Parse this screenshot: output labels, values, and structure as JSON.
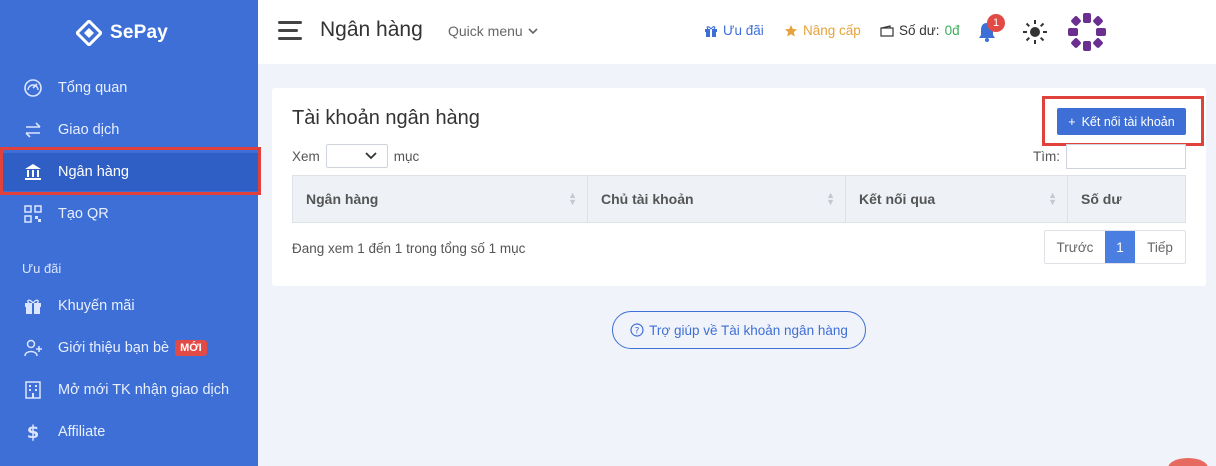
{
  "app": {
    "brand": "SePay"
  },
  "sidebar": {
    "items": [
      {
        "label": "Tổng quan",
        "icon": "dashboard-icon"
      },
      {
        "label": "Giao dịch",
        "icon": "transfer-icon"
      },
      {
        "label": "Ngân hàng",
        "icon": "bank-icon",
        "active": true
      },
      {
        "label": "Tạo QR",
        "icon": "qr-icon"
      }
    ],
    "section_label": "Ưu đãi",
    "promo_items": [
      {
        "label": "Khuyến mãi",
        "icon": "gift-icon"
      },
      {
        "label": "Giới thiệu bạn bè",
        "icon": "user-plus-icon",
        "badge": "MỚI"
      },
      {
        "label": "Mở mới TK nhận giao dịch",
        "icon": "building-icon"
      },
      {
        "label": "Affiliate",
        "icon": "dollar-icon"
      }
    ]
  },
  "header": {
    "title": "Ngân hàng",
    "quick_menu": "Quick menu",
    "promo": "Ưu đãi",
    "upgrade": "Nâng cấp",
    "balance_label": "Số dư:",
    "balance_value": "0đ",
    "notification_count": "1"
  },
  "card": {
    "title": "Tài khoản ngân hàng",
    "connect_button": "Kết nối tài khoản",
    "show_label": "Xem",
    "entries_label": "mục",
    "search_label": "Tìm:",
    "columns": [
      "Ngân hàng",
      "Chủ tài khoản",
      "Kết nối qua",
      "Số dư"
    ],
    "info": "Đang xem 1 đến 1 trong tổng số 1 mục",
    "pager": {
      "prev": "Trước",
      "page": "1",
      "next": "Tiếp"
    }
  },
  "help": {
    "label": "Trợ giúp về Tài khoản ngân hàng"
  },
  "colors": {
    "sidebar": "#3d6fd6",
    "accent": "#3d6fd6",
    "highlight": "#e0413a",
    "balance": "#3cae5c",
    "upgrade": "#e6a23c"
  }
}
